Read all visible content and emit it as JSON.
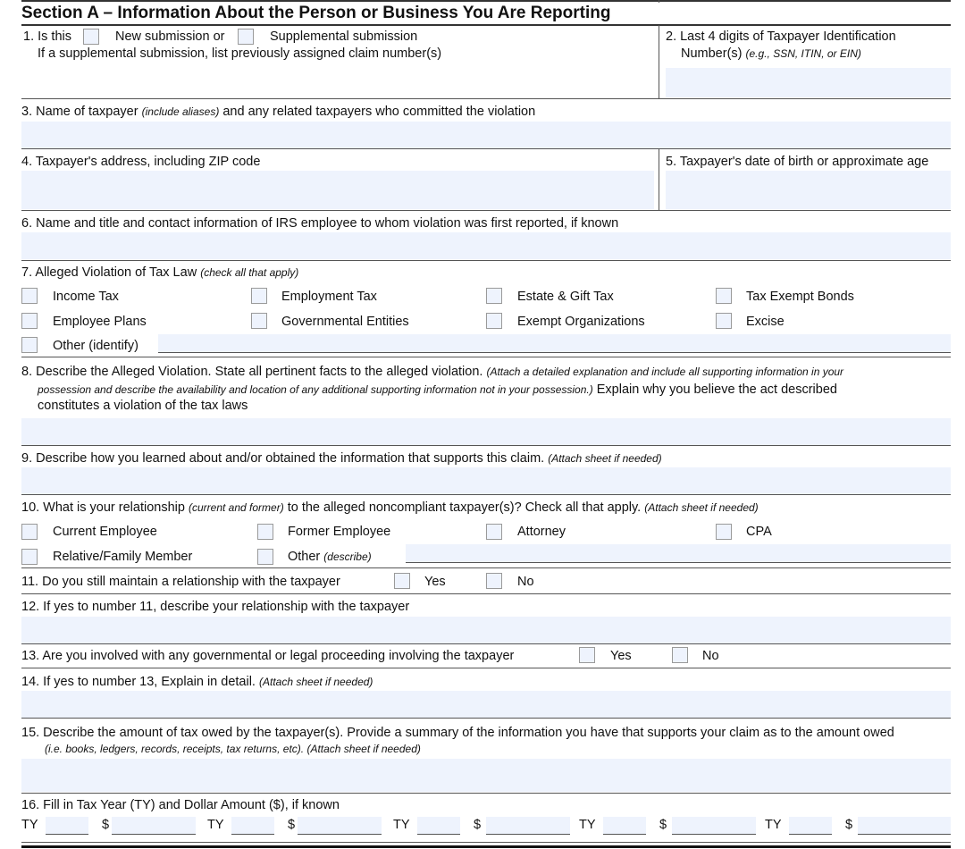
{
  "section": {
    "title": "Section A – Information About the Person or Business You Are Reporting"
  },
  "q1": {
    "prefix": "1. Is this",
    "new_label": "New submission or",
    "supp_label": "Supplemental submission",
    "sub": "If a supplemental submission, list previously assigned claim number(s)"
  },
  "q2": {
    "line1": "2. Last 4 digits of Taxpayer Identification",
    "line2": "Number(s)",
    "hint": "(e.g., SSN, ITIN, or EIN)"
  },
  "q3": {
    "pre": "3. Name of taxpayer",
    "hint": "(include aliases)",
    "post": "and any related taxpayers who committed the violation"
  },
  "q4": {
    "label": "4. Taxpayer's address, including ZIP code"
  },
  "q5": {
    "label": "5. Taxpayer's date of birth or approximate age"
  },
  "q6": {
    "label": "6. Name and title and contact information of IRS employee to whom violation was first reported, if known"
  },
  "q7": {
    "label": "7. Alleged Violation of Tax Law",
    "hint": "(check all that apply)",
    "options": [
      "Income Tax",
      "Employment Tax",
      "Estate & Gift Tax",
      "Tax Exempt Bonds",
      "Employee Plans",
      "Governmental Entities",
      "Exempt Organizations",
      "Excise"
    ],
    "other": "Other (identify)"
  },
  "q8": {
    "pre": "8. Describe the Alleged Violation. State all pertinent facts to the alleged violation.",
    "hint1": "(Attach a detailed explanation and include all supporting information in your",
    "hint2": "possession and describe the availability and location of any additional supporting information not in your possession.)",
    "post2": "Explain why you believe the act described",
    "line3": "constitutes a violation of the tax laws"
  },
  "q9": {
    "label": "9. Describe how you learned about and/or obtained the information that supports this claim.",
    "hint": "(Attach sheet if needed)"
  },
  "q10": {
    "pre": "10. What is your relationship",
    "hint": "(current and former)",
    "post": "to the alleged noncompliant taxpayer(s)? Check all that apply.",
    "hint2": "(Attach sheet if needed)",
    "options": [
      "Current Employee",
      "Former Employee",
      "Attorney",
      "CPA",
      "Relative/Family Member"
    ],
    "other": "Other",
    "other_hint": "(describe)"
  },
  "q11": {
    "label": "11. Do you still maintain a relationship with the taxpayer",
    "yes": "Yes",
    "no": "No"
  },
  "q12": {
    "label": "12. If yes to number 11, describe your relationship with the taxpayer"
  },
  "q13": {
    "label": "13. Are you involved with any governmental or legal proceeding involving the taxpayer",
    "yes": "Yes",
    "no": "No"
  },
  "q14": {
    "label": "14. If yes to number 13, Explain in detail.",
    "hint": "(Attach sheet if needed)"
  },
  "q15": {
    "label": "15. Describe the amount of tax owed by the taxpayer(s). Provide a summary of the information you have that supports your claim as to the amount owed",
    "hint": "(i.e. books, ledgers, records, receipts, tax returns, etc). (Attach sheet if needed)"
  },
  "q16": {
    "label": "16. Fill in Tax Year (TY) and Dollar Amount ($), if known",
    "ty": "TY",
    "dollar": "$"
  }
}
